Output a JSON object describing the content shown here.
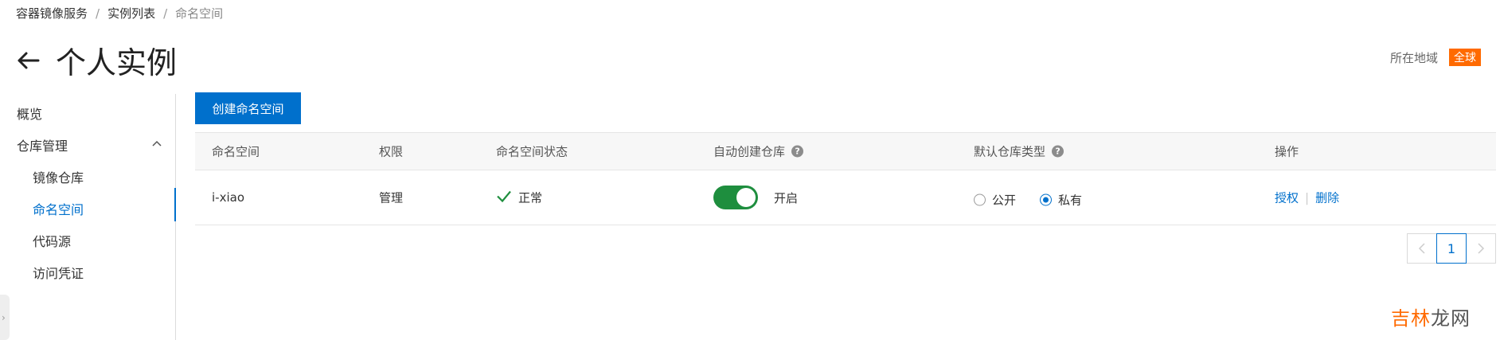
{
  "breadcrumb": {
    "items": [
      "容器镜像服务",
      "实例列表",
      "命名空间"
    ]
  },
  "header": {
    "title": "个人实例"
  },
  "region": {
    "label": "所在地域",
    "value": "全球",
    "badge_color": "#ff6a00"
  },
  "sidebar": {
    "overview": "概览",
    "repo_group": "仓库管理",
    "repos": "镜像仓库",
    "namespaces": "命名空间",
    "code_source": "代码源",
    "access_credential": "访问凭证"
  },
  "toolbar": {
    "create_label": "创建命名空间"
  },
  "table": {
    "headers": [
      "命名空间",
      "权限",
      "命名空间状态",
      "自动创建仓库",
      "默认仓库类型",
      "操作"
    ],
    "rows": [
      {
        "name": "i-xiao",
        "permission": "管理",
        "status": "正常",
        "auto_create": {
          "on": true,
          "label": "开启"
        },
        "repo_type": {
          "options": [
            "公开",
            "私有"
          ],
          "selected": "私有"
        },
        "actions": [
          "授权",
          "删除"
        ]
      }
    ]
  },
  "pagination": {
    "current": "1"
  },
  "watermark": {
    "accent": "吉林",
    "rest": "龙网"
  },
  "colors": {
    "accent": "#0070cc",
    "toggle_on": "#1e8e3e",
    "ok_check": "#1e8e3e"
  },
  "icons": [
    "back-arrow-icon",
    "chevron-up-icon",
    "check-icon",
    "help-icon",
    "chevron-left-icon",
    "chevron-right-icon"
  ]
}
